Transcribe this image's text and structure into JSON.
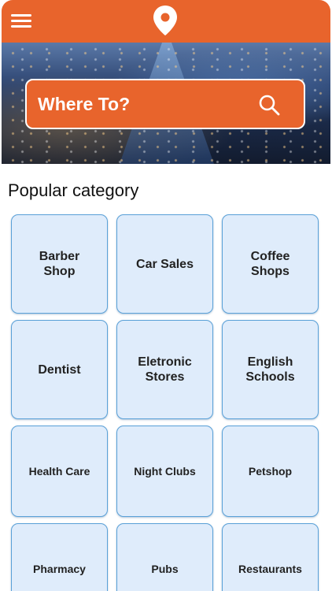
{
  "header": {
    "menu_icon": "hamburger-menu-icon",
    "logo_icon": "map-pin-icon"
  },
  "hero": {
    "search_label": "Where To?",
    "search_icon": "magnifier-icon"
  },
  "colors": {
    "accent": "#e8642c",
    "tile_bg": "#dfecfb",
    "tile_border": "#5aa1d8"
  },
  "section": {
    "title": "Popular category"
  },
  "categories": [
    {
      "label": "Barber\nShop"
    },
    {
      "label": "Car Sales"
    },
    {
      "label": "Coffee\nShops"
    },
    {
      "label": "Dentist"
    },
    {
      "label": "Eletronic\nStores"
    },
    {
      "label": "English\nSchools"
    },
    {
      "label": "Health Care"
    },
    {
      "label": "Night Clubs"
    },
    {
      "label": "Petshop"
    },
    {
      "label": "Pharmacy"
    },
    {
      "label": "Pubs"
    },
    {
      "label": "Restaurants"
    }
  ]
}
